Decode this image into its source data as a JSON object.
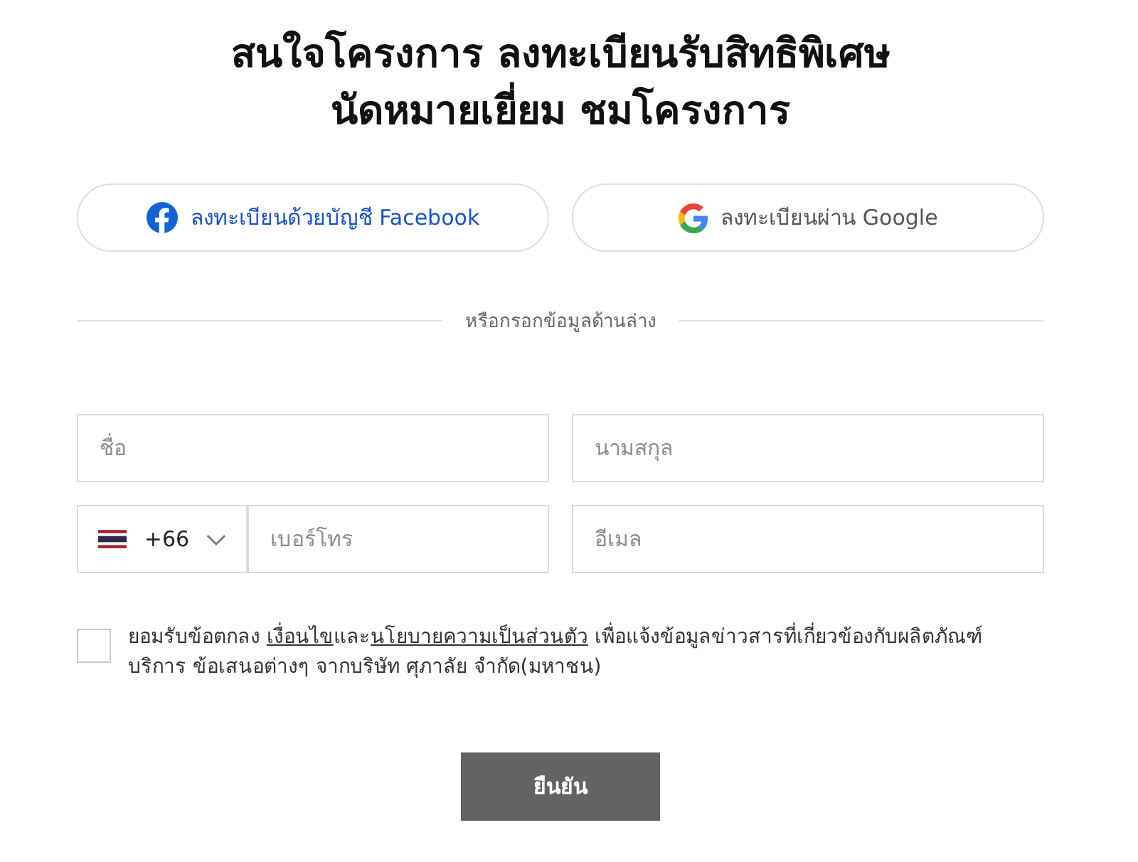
{
  "heading": {
    "lines": [
      "สนใจโครงการ ลงทะเบียนรับสิทธิพิเศษ",
      "นัดหมายเยี่ยม ชมโครงการ"
    ]
  },
  "social_buttons": [
    {
      "kind": "facebook",
      "label": "ลงทะเบียนด้วยบัญชี Facebook"
    },
    {
      "kind": "google",
      "label": "ลงทะเบียนผ่าน Google"
    }
  ],
  "divider": {
    "label": "หรือกรอกข้อมูลด้านล่าง"
  },
  "fields": [
    {
      "kind": "text",
      "placeholder": "ชื่อ"
    },
    {
      "kind": "text",
      "placeholder": "นามสกุล"
    },
    {
      "kind": "phone",
      "country_code": "+66",
      "placeholder": "เบอร์โทร"
    },
    {
      "kind": "text",
      "placeholder": "อีเมล"
    }
  ],
  "consent": {
    "checked": false,
    "parts": [
      {
        "kind": "text",
        "text": "ยอมรับข้อตกลง "
      },
      {
        "kind": "link",
        "text": "เงื่อนไข"
      },
      {
        "kind": "text",
        "text": "และ"
      },
      {
        "kind": "link",
        "text": "นโยบายความเป็นส่วนตัว"
      },
      {
        "kind": "text",
        "text": " เพื่อแจ้งข้อมูลข่าวสารที่เกี่ยวข้องกับผลิตภัณฑ์ บริการ ข้อเสนอต่างๆ จากบริษัท ศุภาลัย จำกัด(มหาชน)"
      }
    ]
  },
  "submit_button": {
    "label": "ยืนยัน"
  }
}
